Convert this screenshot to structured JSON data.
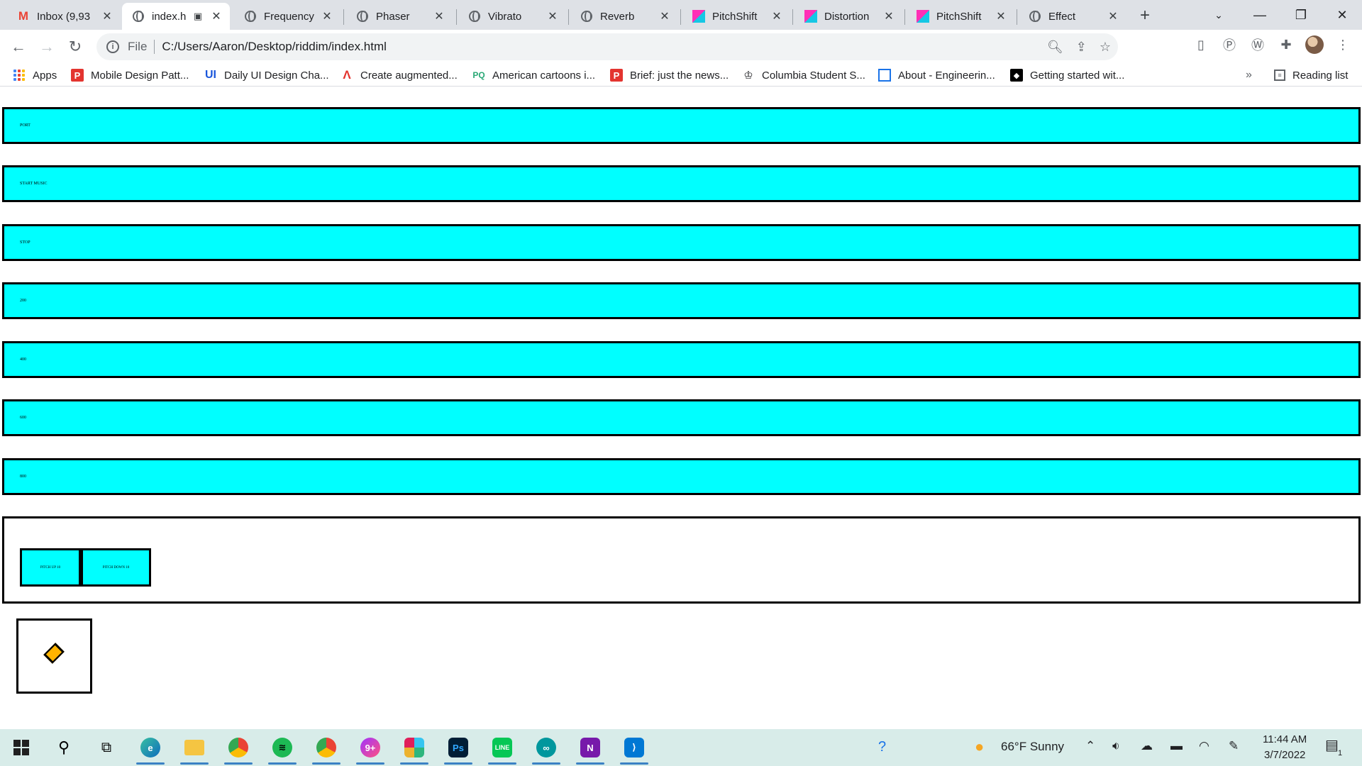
{
  "tabs": [
    {
      "title": "Inbox (9,93",
      "icon": "gmail-icon",
      "active": false
    },
    {
      "title": "index.h",
      "icon": "globe-icon",
      "active": true
    },
    {
      "title": "Frequency",
      "icon": "globe-icon",
      "active": false
    },
    {
      "title": "Phaser",
      "icon": "globe-icon",
      "active": false
    },
    {
      "title": "Vibrato",
      "icon": "globe-icon",
      "active": false
    },
    {
      "title": "Reverb",
      "icon": "globe-icon",
      "active": false
    },
    {
      "title": "PitchShift",
      "icon": "pitchshift-icon",
      "active": false
    },
    {
      "title": "Distortion",
      "icon": "pitchshift-icon",
      "active": false
    },
    {
      "title": "PitchShift",
      "icon": "pitchshift-icon",
      "active": false
    },
    {
      "title": "Effect",
      "icon": "globe-icon",
      "active": false
    }
  ],
  "omnibox": {
    "scheme": "File",
    "url": "C:/Users/Aaron/Desktop/riddim/index.html"
  },
  "bookmarks": [
    {
      "label": "Apps"
    },
    {
      "label": "Mobile Design Patt..."
    },
    {
      "label": "Daily UI Design Cha..."
    },
    {
      "label": "Create augmented..."
    },
    {
      "label": "American cartoons i..."
    },
    {
      "label": "Brief: just the news..."
    },
    {
      "label": "Columbia Student S..."
    },
    {
      "label": "About - Engineerin..."
    },
    {
      "label": "Getting started wit..."
    }
  ],
  "reading_list": "Reading list",
  "page": {
    "buttons": [
      "PORT",
      "START MUSIC",
      "STOP",
      "200",
      "400",
      "600",
      "800"
    ],
    "pitch_up": "PITCH UP 10",
    "pitch_down": "PITCH DOWN 10",
    "accent_color": "#00ffff",
    "diamond_color": "#ffb400"
  },
  "taskbar": {
    "weather": "66°F  Sunny",
    "time": "11:44 AM",
    "date": "3/7/2022",
    "notification_count": "1"
  }
}
